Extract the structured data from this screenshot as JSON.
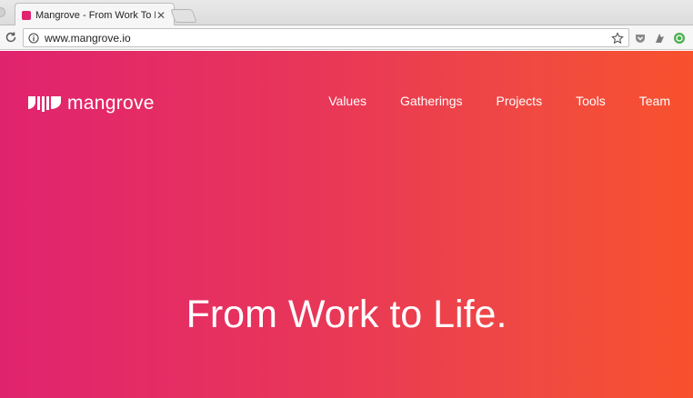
{
  "browser": {
    "tab_title": "Mangrove - From Work To Life",
    "tab_close": "✕",
    "url": "www.mangrove.io"
  },
  "site": {
    "logo_text": "mangrove",
    "nav": [
      "Values",
      "Gatherings",
      "Projects",
      "Tools",
      "Team"
    ],
    "headline": "From Work to Life."
  },
  "colors": {
    "gradient_start": "#e1236f",
    "gradient_end": "#f8512e"
  }
}
